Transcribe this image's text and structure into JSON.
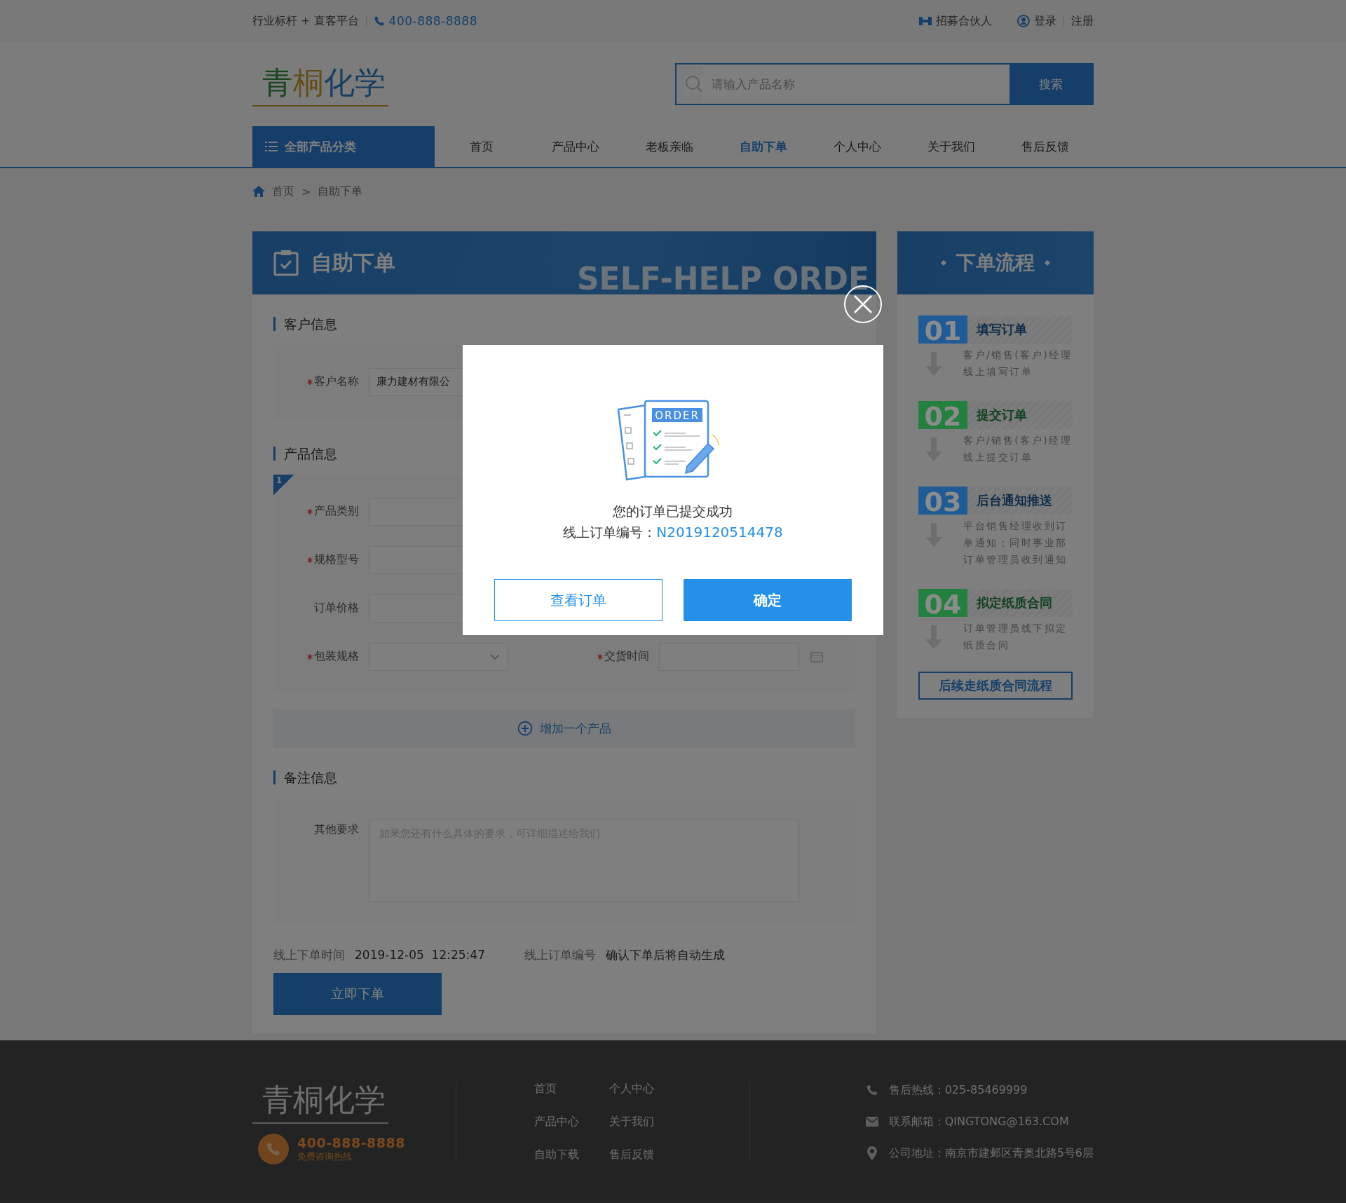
{
  "top_bar": {
    "slogan": "行业标杆 + 直客平台",
    "phone": "400-888-8888",
    "partner": "招募合伙人",
    "login": "登录",
    "register": "注册"
  },
  "header": {
    "logo": "青桐化学",
    "search": {
      "placeholder": "请输入产品名称",
      "button": "搜索"
    }
  },
  "nav": {
    "category_button": "全部产品分类",
    "items": [
      {
        "label": "首页",
        "selected": false
      },
      {
        "label": "产品中心",
        "selected": false
      },
      {
        "label": "老板亲临",
        "selected": false
      },
      {
        "label": "自助下单",
        "selected": true
      },
      {
        "label": "个人中心",
        "selected": false
      },
      {
        "label": "关于我们",
        "selected": false
      },
      {
        "label": "售后反馈",
        "selected": false
      }
    ]
  },
  "breadcrumb": {
    "items": [
      "首页",
      "自助下单"
    ],
    "separator": ">"
  },
  "order_form": {
    "title": "自助下单",
    "watermark": "SELF-HELP ORDE",
    "customer_section": {
      "heading": "客户信息",
      "fields": [
        {
          "label": "客户名称",
          "required": true,
          "value": "康力建材有限公"
        }
      ]
    },
    "product_section": {
      "heading": "产品信息",
      "index": "1",
      "fields": [
        {
          "label": "产品类别",
          "required": true,
          "kind": "input"
        },
        {
          "label": "规格型号",
          "required": true,
          "kind": "input"
        },
        {
          "label": "订单价格",
          "required": false,
          "kind": "input"
        },
        {
          "label": "包装规格",
          "required": true,
          "kind": "select"
        }
      ],
      "delivery_field": {
        "label": "交货时间",
        "required": true
      },
      "add_button": "增加一个产品"
    },
    "remarks_section": {
      "heading": "备注信息",
      "label": "其他要求",
      "placeholder": "如果您还有什么具体的要求，可详细描述给我们"
    },
    "meta": [
      {
        "label": "线上下单时间",
        "value": "2019-12-05  12:25:47"
      },
      {
        "label": "线上订单编号",
        "value": "确认下单后将自动生成"
      }
    ],
    "submit_button": "立即下单"
  },
  "process": {
    "title": "下单流程",
    "steps": [
      {
        "number": "01",
        "title": "填写订单",
        "description": "客户/销售(客户)经理线上填写订单",
        "color": "#1f5b96"
      },
      {
        "number": "02",
        "title": "提交订单",
        "description": "客户/销售(客户)经理线上提交订单",
        "color": "#23803f"
      },
      {
        "number": "03",
        "title": "后台通知推送",
        "description": "平台销售经理收到订单通知；同时事业部订单管理员收到通知",
        "color": "#1f5b96"
      },
      {
        "number": "04",
        "title": "拟定纸质合同",
        "description": "订单管理员线下拟定纸质合同",
        "color": "#23803f"
      }
    ],
    "button": "后续走纸质合同流程"
  },
  "footer": {
    "logo": "青桐化学",
    "hotline": "400-888-8888",
    "hotline_caption": "免费咨询热线",
    "links": [
      "首页",
      "个人中心",
      "产品中心",
      "关于我们",
      "自助下载",
      "售后反馈"
    ],
    "contacts": [
      {
        "kind": "phone",
        "text": "售后热线：025-85469999"
      },
      {
        "kind": "mail",
        "text": "联系邮箱：QINGTONG@163.COM"
      },
      {
        "kind": "location",
        "text": "公司地址：南京市建邺区青奥北路5号6层"
      }
    ]
  },
  "modal": {
    "illustration_label": "ORDER",
    "message": "您的订单已提交成功",
    "order_label": "线上订单编号：",
    "order_number": "N2019120514478",
    "buttons": [
      {
        "label": "查看订单",
        "kind": "secondary"
      },
      {
        "label": "确定",
        "kind": "primary"
      }
    ]
  }
}
